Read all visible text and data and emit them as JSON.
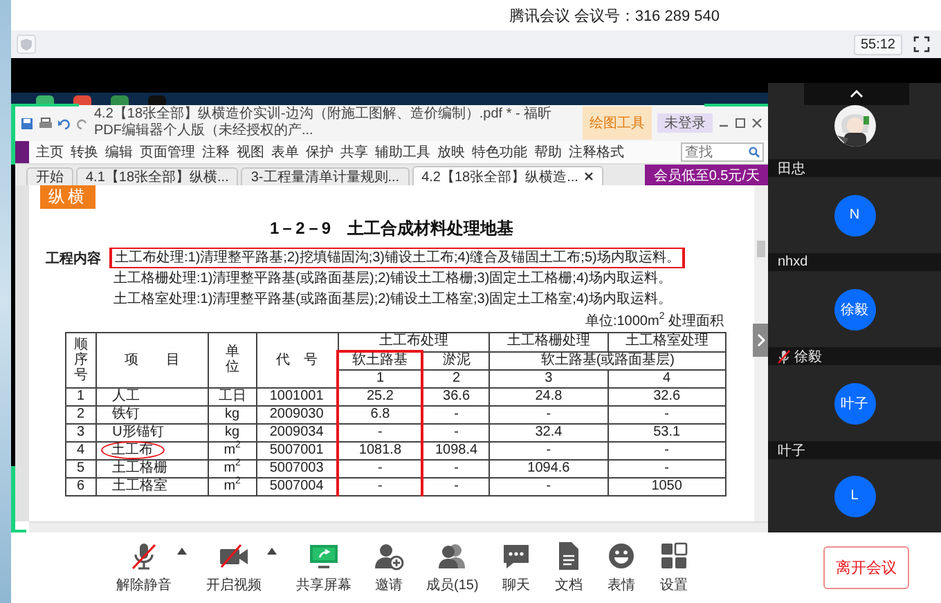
{
  "meeting": {
    "title": "腾讯会议 会议号：316 289 540",
    "timer": "55:12"
  },
  "pdf_window": {
    "title": "4.2【18张全部】纵横造价实训-边沟（附施工图解、造价编制）.pdf * - 福昕PDF编辑器个人版（未经授权的产...",
    "context_tab": "绘图工具",
    "login": "未登录",
    "menu": [
      "主页",
      "转换",
      "编辑",
      "页面管理",
      "注释",
      "视图",
      "表单",
      "保护",
      "共享",
      "辅助工具",
      "放映",
      "特色功能",
      "帮助",
      "注释格式"
    ],
    "search": {
      "placeholder": "查找"
    },
    "tabs": [
      {
        "label": "开始",
        "selected": false,
        "closable": false
      },
      {
        "label": "4.1【18张全部】纵横...",
        "selected": false,
        "closable": false
      },
      {
        "label": "3-工程量清单计量规则...",
        "selected": false,
        "closable": false
      },
      {
        "label": "4.2【18张全部】纵横造...",
        "selected": true,
        "closable": true
      }
    ],
    "promo": "会员低至0.5元/天"
  },
  "document": {
    "logo": "纵横",
    "heading": "1－2－9　土工合成材料处理地基",
    "content_label": "工程内容",
    "content_lines": [
      {
        "text": "土工布处理:1)清理整平路基;2)挖填锚固沟;3)铺设土工布;4)缝合及锚固土工布;5)场内取运料。",
        "annotated": true
      },
      {
        "text": "土工格栅处理:1)清理整平路基(或路面基层);2)铺设土工格栅;3)固定土工格栅;4)场内取运料。",
        "annotated": false
      },
      {
        "text": "土工格室处理:1)清理整平路基(或路面基层);2)铺设土工格室;3)固定土工格室;4)场内取运料。",
        "annotated": false
      }
    ],
    "unit": "单位:1000m$^{2}$ 处理面积",
    "table": {
      "fixed_headers": [
        "顺序号",
        "项　　目",
        "单位",
        "代　号"
      ],
      "group_headers": [
        "土工布处理",
        "土工格栅处理",
        "土工格室处理"
      ],
      "value_columns": [
        {
          "sub_header": "软土路基",
          "number": "1",
          "annotated": true
        },
        {
          "sub_header": "淤泥",
          "number": "2",
          "annotated": false
        },
        {
          "sub_header": "软土路基(或路面基层)",
          "number": "3",
          "annotated": false
        },
        {
          "number": "4",
          "annotated": false
        }
      ],
      "rows": [
        {
          "no": "1",
          "item": "人工",
          "circled": false,
          "unit": "工日",
          "code": "1001001",
          "values": [
            "25.2",
            "36.6",
            "24.8",
            "32.6"
          ]
        },
        {
          "no": "2",
          "item": "铁钉",
          "circled": false,
          "unit": "kg",
          "code": "2009030",
          "values": [
            "6.8",
            "-",
            "-",
            "-"
          ]
        },
        {
          "no": "3",
          "item": "U形锚钉",
          "circled": false,
          "unit": "kg",
          "code": "2009034",
          "values": [
            "-",
            "-",
            "32.4",
            "53.1"
          ]
        },
        {
          "no": "4",
          "item": "土工布",
          "circled": true,
          "unit": "m$^{2}$",
          "code": "5007001",
          "values": [
            "1081.8",
            "1098.4",
            "-",
            "-"
          ]
        },
        {
          "no": "5",
          "item": "土工格栅",
          "circled": false,
          "unit": "m$^{2}$",
          "code": "5007003",
          "values": [
            "-",
            "-",
            "1094.6",
            "-"
          ]
        },
        {
          "no": "6",
          "item": "土工格室",
          "circled": false,
          "unit": "m$^{2}$",
          "code": "5007004",
          "values": [
            "-",
            "-",
            "-",
            "1050"
          ]
        }
      ]
    }
  },
  "participants": [
    {
      "name": "田忠",
      "muted": false
    },
    {
      "avatar": {
        "kind": "initials",
        "text": "N"
      },
      "name": "nhxd",
      "muted": false
    },
    {
      "avatar": {
        "kind": "initials",
        "text": "徐毅"
      },
      "name": "徐毅",
      "muted": true
    },
    {
      "avatar": {
        "kind": "initials",
        "text": "叶子"
      },
      "name": "叶子",
      "muted": false
    },
    {
      "avatar": {
        "kind": "initials",
        "text": "L"
      }
    }
  ],
  "toolbar": {
    "items": [
      {
        "kind": "mic",
        "label": "解除静音",
        "muted": true,
        "dropdown": true
      },
      {
        "kind": "camera",
        "label": "开启视频",
        "camera_on": false,
        "dropdown": true
      },
      {
        "kind": "share",
        "label": "共享屏幕",
        "dropdown": false
      },
      {
        "kind": "invite",
        "label": "邀请",
        "dropdown": false
      },
      {
        "kind": "members",
        "label": "成员(15)",
        "dropdown": false
      },
      {
        "kind": "chat",
        "label": "聊天",
        "dropdown": false
      },
      {
        "kind": "docs",
        "label": "文档",
        "dropdown": false
      },
      {
        "kind": "emoji",
        "label": "表情",
        "dropdown": false
      },
      {
        "kind": "settings",
        "label": "设置",
        "dropdown": false
      }
    ],
    "leave": "离开会议"
  }
}
